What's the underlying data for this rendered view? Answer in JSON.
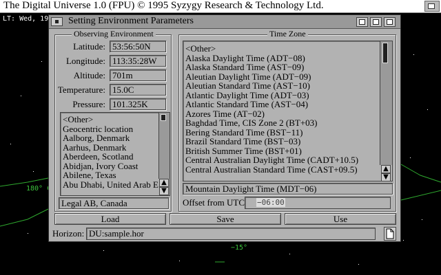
{
  "screen": {
    "title": "The Digital Universe 1.0 (FPU) © 1995 Syzygy Research & Technology Ltd.",
    "lt_readout": "LT: Wed, 19",
    "sky_labels": {
      "left": "180° C",
      "bottom": "−15°"
    }
  },
  "dialog": {
    "title": "Setting Environment Parameters",
    "observing": {
      "group_title": "Observing Environment",
      "fields": [
        {
          "label": "Latitude:",
          "value": "53:56:50N"
        },
        {
          "label": "Longitude:",
          "value": "113:35:28W"
        },
        {
          "label": "Altitude:",
          "value": "701m"
        },
        {
          "label": "Temperature:",
          "value": "15.0C"
        },
        {
          "label": "Pressure:",
          "value": "101.325K"
        }
      ],
      "locations": [
        "<Other>",
        "Geocentric location",
        "Aalborg, Denmark",
        "Aarhus, Denmark",
        "Aberdeen, Scotland",
        "Abidjan, Ivory Coast",
        "Abilene, Texas",
        "Abu Dhabi, United Arab E"
      ],
      "selected_location": "Legal AB, Canada"
    },
    "timezone": {
      "group_title": "Time Zone",
      "zones": [
        "<Other>",
        "Alaska Daylight Time (ADT−08)",
        "Alaska Standard Time (AST−09)",
        "Aleutian Daylight Time (ADT−09)",
        "Aleutian Standard Time (AST−10)",
        "Atlantic Daylight Time (ADT−03)",
        "Atlantic Standard Time (AST−04)",
        "Azores Time (AT−02)",
        "Baghdad Time, CIS Zone 2 (BT+03)",
        "Bering Standard Time (BST−11)",
        "Brazil Standard Time (BST−03)",
        "British Summer Time (BST+01)",
        "Central Australian Daylight Time (CADT+10.5)",
        "Central Australian Standard Time (CAST+09.5)"
      ],
      "selected_zone": "Mountain Daylight Time (MDT−06)",
      "offset_label": "Offset from UTC:",
      "offset_value": "−06:00"
    },
    "buttons": {
      "load": "Load",
      "save": "Save",
      "use": "Use"
    },
    "horizon": {
      "label": "Horizon:",
      "value": "DU:sample.hor"
    }
  }
}
